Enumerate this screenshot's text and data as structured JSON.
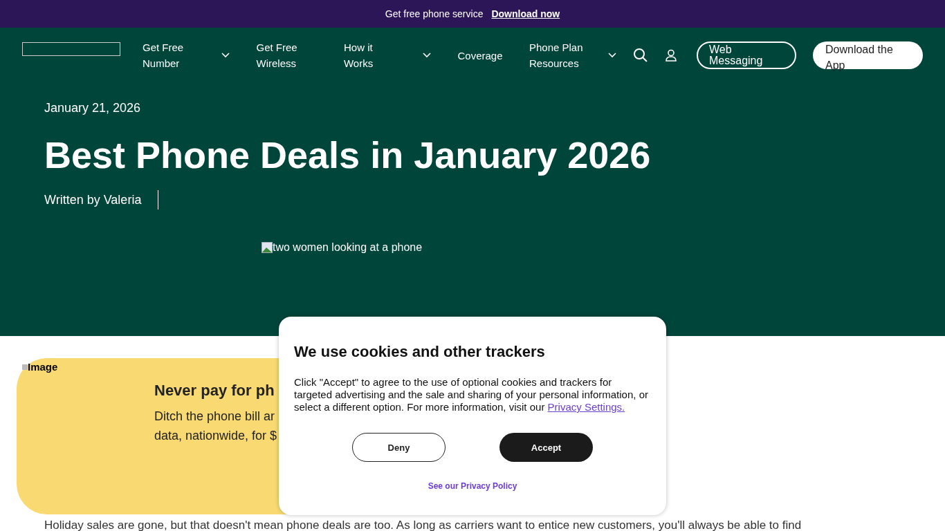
{
  "promo_bar": {
    "text": "Get free phone service",
    "link": "Download now"
  },
  "nav": {
    "items": [
      {
        "label": "Get Free Number",
        "dropdown": true
      },
      {
        "label": "Get Free Wireless",
        "dropdown": false
      },
      {
        "label": "How it Works",
        "dropdown": true
      },
      {
        "label": "Coverage",
        "dropdown": false
      },
      {
        "label": "Phone Plan Resources",
        "dropdown": true
      }
    ],
    "web_messaging": "Web Messaging",
    "download_app": "Download the App"
  },
  "hero": {
    "date": "January 21, 2026",
    "title": "Best Phone Deals in January 2026",
    "author": "Written by Valeria",
    "image_alt": "two women looking at a phone"
  },
  "promo_card": {
    "image_alt": "Image",
    "heading": "Never pay for ph",
    "lines": [
      "Ditch the phone bill ar",
      "data, nationwide, for $"
    ]
  },
  "body_text": "Holiday sales are gone, but that doesn't mean phone deals are too. As long as carriers want to entice new customers, you'll always be able to find",
  "cookie_dialog": {
    "title": "We use cookies and other trackers",
    "text": "Click \"Accept\" to agree to the use of optional cookies and trackers for targeted advertising and the sale and sharing of your personal information, or select a different option. For more information, visit our",
    "link": "Privacy Settings.",
    "buttons": [
      {
        "label": "Deny",
        "kind": "outline"
      },
      {
        "label": "Accept",
        "kind": "filled"
      }
    ],
    "policy_link": "See our Privacy Policy"
  }
}
